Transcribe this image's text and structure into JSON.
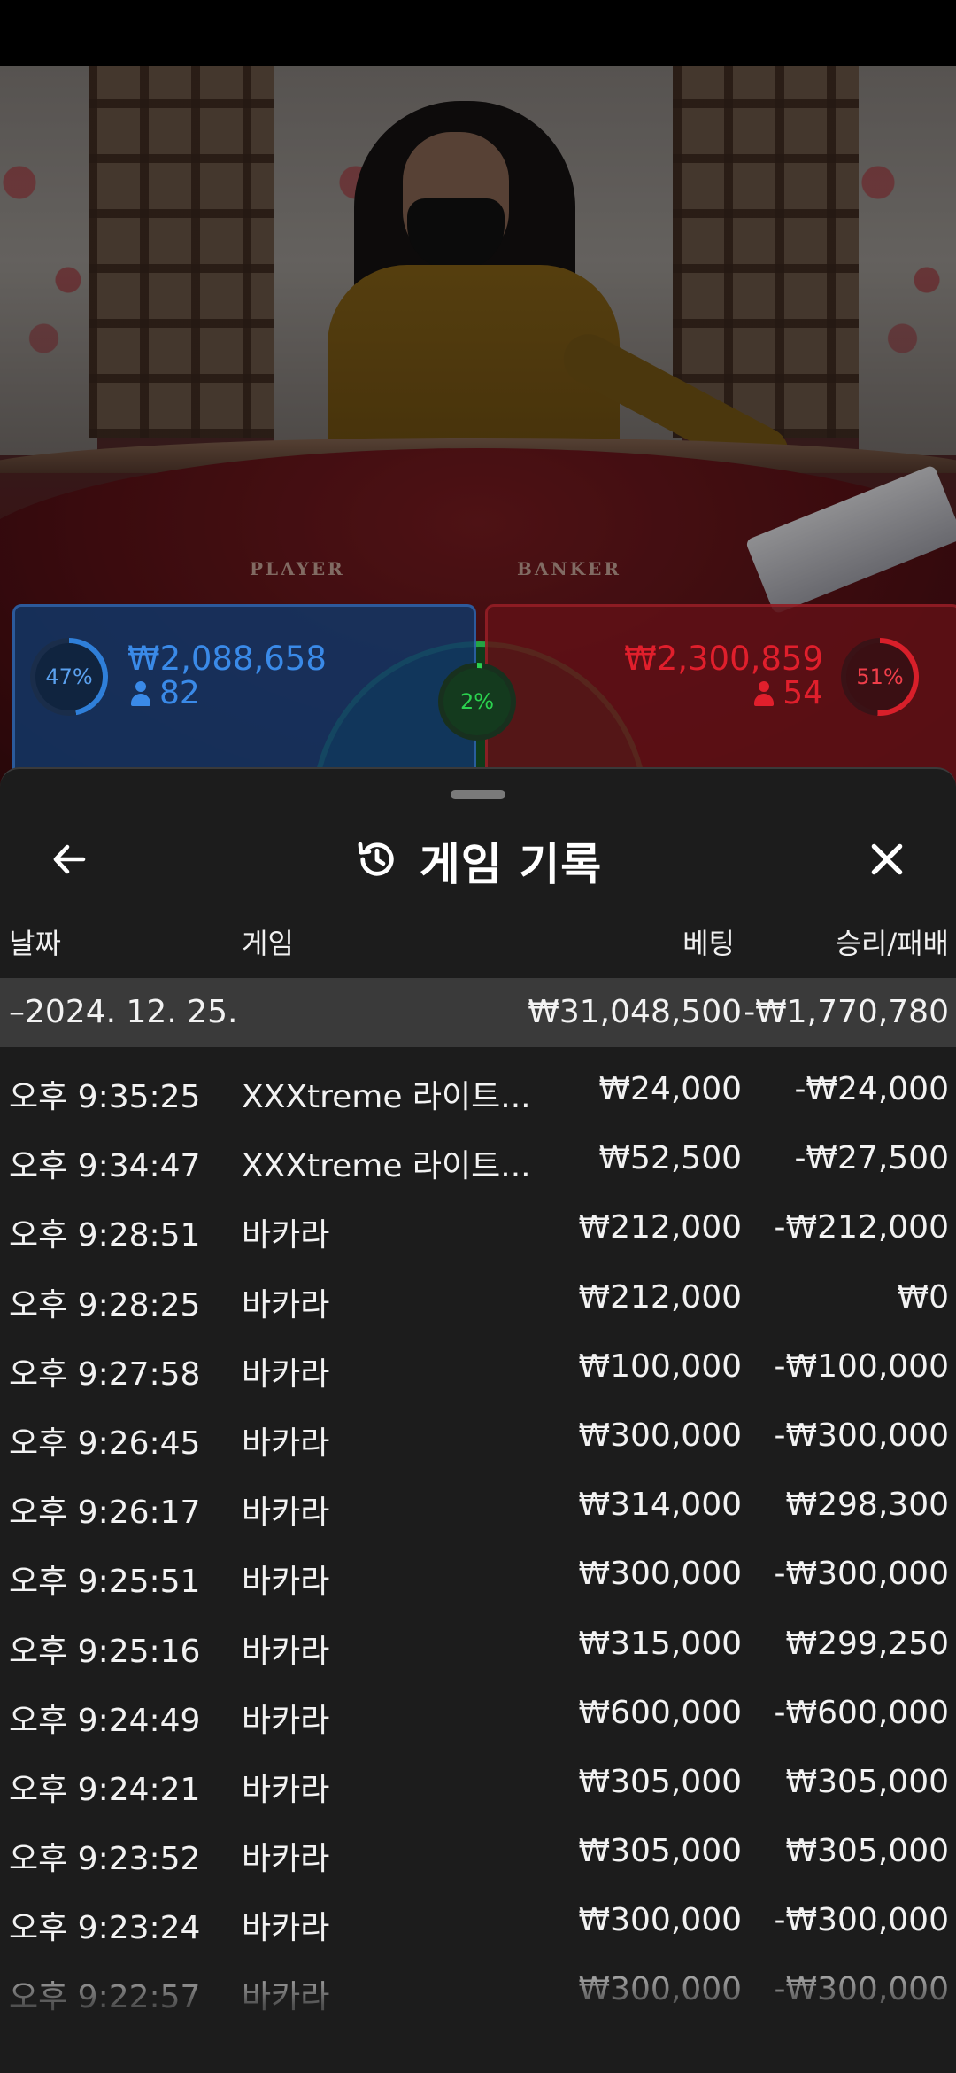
{
  "video": {
    "player_label": "PLAYER",
    "banker_label": "BANKER"
  },
  "bets": {
    "player": {
      "percent": "47%",
      "amount": "₩2,088,658",
      "count": "82"
    },
    "banker": {
      "percent": "51%",
      "amount": "₩2,300,859",
      "count": "54"
    },
    "tie": {
      "percent": "2%"
    }
  },
  "colors": {
    "player": "#3a8ae8",
    "banker": "#e01f2c",
    "tie": "#2bd24f",
    "sheet_bg": "#1c1c1c",
    "date_row_bg": "#3a3a3a"
  },
  "history": {
    "title": "게임 기록",
    "icons": {
      "back": "arrow-left-icon",
      "title": "history-icon",
      "close": "close-icon"
    },
    "columns": {
      "date": "날짜",
      "game": "게임",
      "bet": "베팅",
      "result": "승리/패배"
    },
    "date_group": {
      "date": "–2024. 12. 25.",
      "bet": "₩31,048,500",
      "result": "-₩1,770,780"
    },
    "rows": [
      {
        "time": "오후 9:35:25",
        "game": "XXXtreme 라이트...",
        "bet": "₩24,000",
        "result": "-₩24,000"
      },
      {
        "time": "오후 9:34:47",
        "game": "XXXtreme 라이트...",
        "bet": "₩52,500",
        "result": "-₩27,500"
      },
      {
        "time": "오후 9:28:51",
        "game": "바카라",
        "bet": "₩212,000",
        "result": "-₩212,000"
      },
      {
        "time": "오후 9:28:25",
        "game": "바카라",
        "bet": "₩212,000",
        "result": "₩0"
      },
      {
        "time": "오후 9:27:58",
        "game": "바카라",
        "bet": "₩100,000",
        "result": "-₩100,000"
      },
      {
        "time": "오후 9:26:45",
        "game": "바카라",
        "bet": "₩300,000",
        "result": "-₩300,000"
      },
      {
        "time": "오후 9:26:17",
        "game": "바카라",
        "bet": "₩314,000",
        "result": "₩298,300"
      },
      {
        "time": "오후 9:25:51",
        "game": "바카라",
        "bet": "₩300,000",
        "result": "-₩300,000"
      },
      {
        "time": "오후 9:25:16",
        "game": "바카라",
        "bet": "₩315,000",
        "result": "₩299,250"
      },
      {
        "time": "오후 9:24:49",
        "game": "바카라",
        "bet": "₩600,000",
        "result": "-₩600,000"
      },
      {
        "time": "오후 9:24:21",
        "game": "바카라",
        "bet": "₩305,000",
        "result": "₩305,000"
      },
      {
        "time": "오후 9:23:52",
        "game": "바카라",
        "bet": "₩305,000",
        "result": "₩305,000"
      },
      {
        "time": "오후 9:23:24",
        "game": "바카라",
        "bet": "₩300,000",
        "result": "-₩300,000"
      },
      {
        "time": "오후 9:22:57",
        "game": "바카라",
        "bet": "₩300,000",
        "result": "-₩300,000"
      }
    ]
  }
}
